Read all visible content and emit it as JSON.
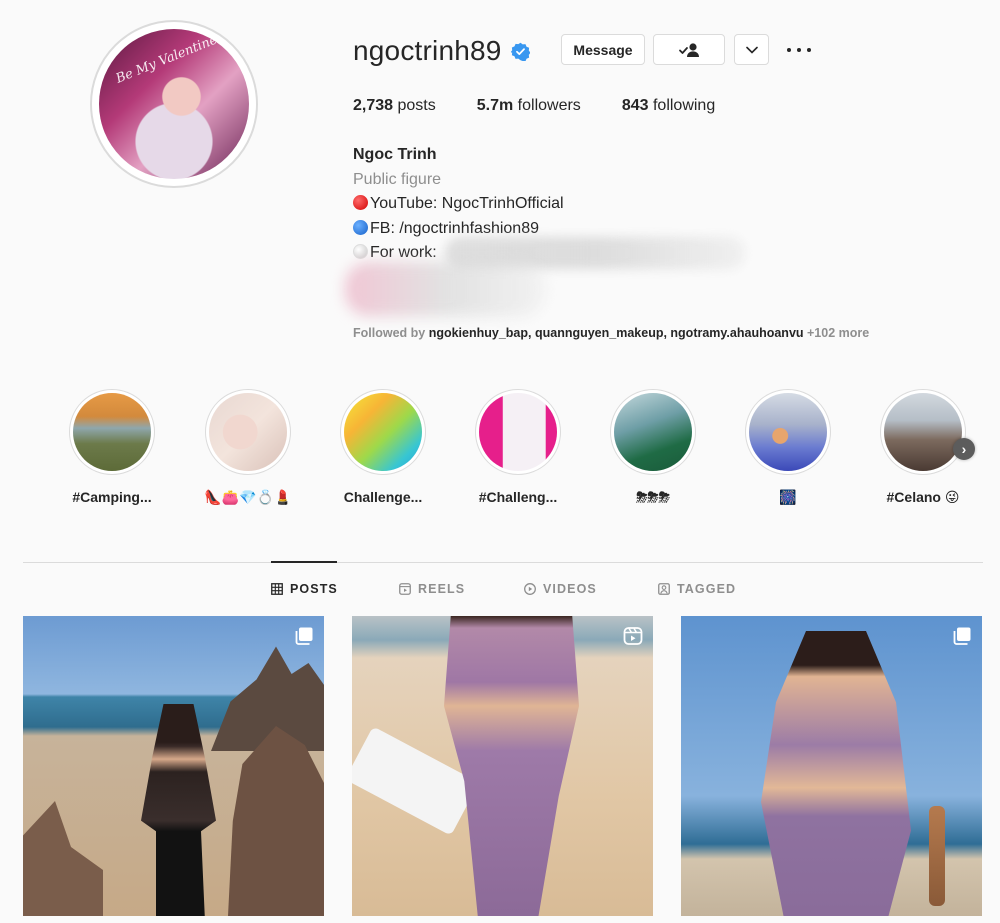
{
  "profile": {
    "username": "ngoctrinh89",
    "verified": true,
    "avatar_text": "Be My Valentine",
    "buttons": {
      "message": "Message",
      "follow_icon": "person-check-icon",
      "dropdown_icon": "chevron-down-icon",
      "more_icon": "more-horizontal-icon"
    },
    "stats": {
      "posts_count": "2,738",
      "posts_label": "posts",
      "followers_count": "5.7m",
      "followers_label": "followers",
      "following_count": "843",
      "following_label": "following"
    },
    "bio": {
      "name": "Ngoc Trinh",
      "category": "Public figure",
      "line1": "YouTube: NgocTrinhOfficial",
      "line2": "FB: /ngoctrinhfashion89",
      "line3": "For work: "
    },
    "followed_by": {
      "prefix": "Followed by ",
      "users": "ngokienhuy_bap, quannguyen_makeup, ngotramy.ahauhoanvu",
      "more": " +102 more"
    }
  },
  "highlights": [
    {
      "label": "#Camping..."
    },
    {
      "label": "👠👛💎💍💄"
    },
    {
      "label": "Challenge..."
    },
    {
      "label": "#Challeng..."
    },
    {
      "label": "⛈⛈⛈"
    },
    {
      "label": "🎆"
    },
    {
      "label": "#Celano 😜"
    }
  ],
  "tabs": [
    {
      "label": "POSTS",
      "icon": "grid-icon",
      "active": true
    },
    {
      "label": "REELS",
      "icon": "reels-icon",
      "active": false
    },
    {
      "label": "VIDEOS",
      "icon": "play-icon",
      "active": false
    },
    {
      "label": "TAGGED",
      "icon": "tag-icon",
      "active": false
    }
  ],
  "posts": [
    {
      "type_icon": "carousel-icon"
    },
    {
      "type_icon": "reels-icon"
    },
    {
      "type_icon": "carousel-icon"
    }
  ],
  "colors": {
    "text": "#262626",
    "secondary": "#8e8e8e",
    "border": "#dbdbdb",
    "verified": "#3897f0",
    "background": "#fafafa"
  }
}
